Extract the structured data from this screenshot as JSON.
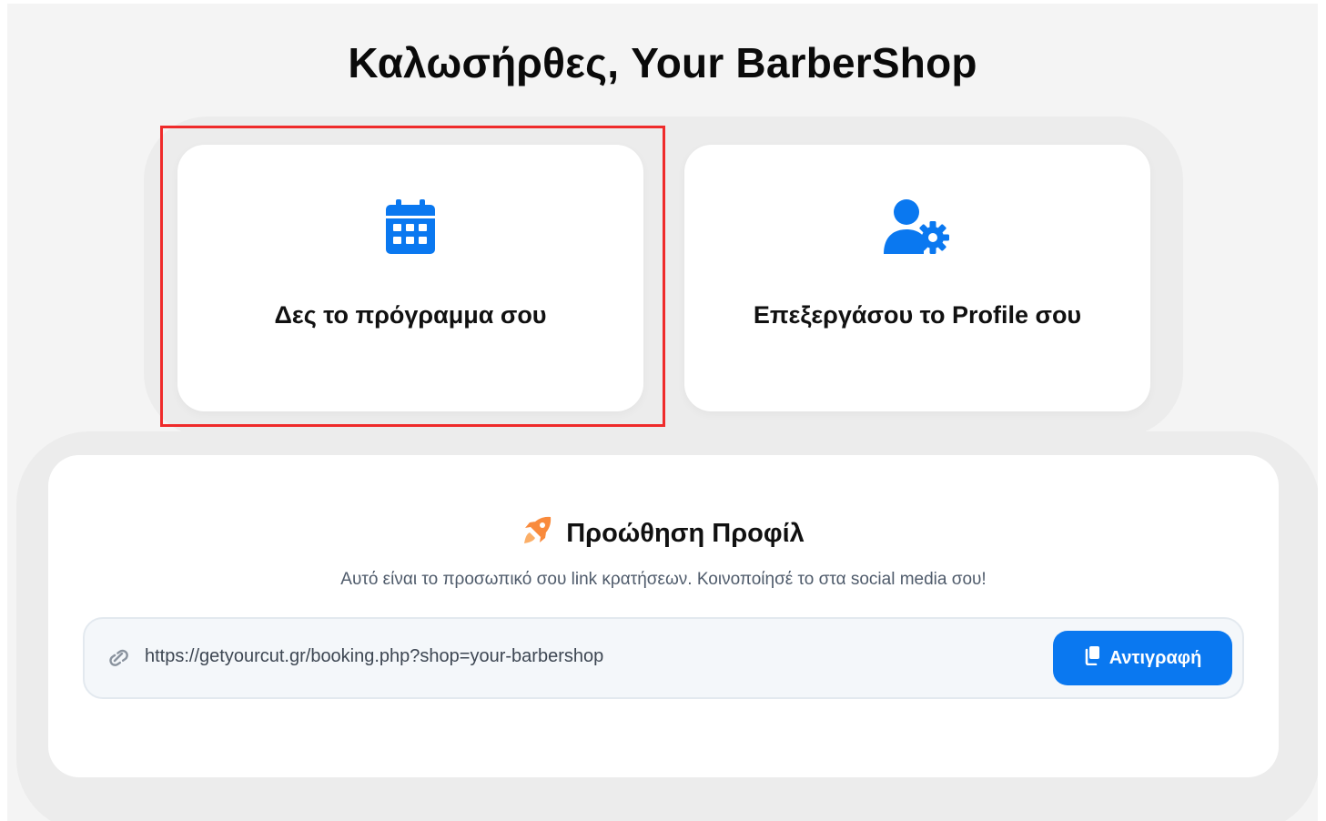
{
  "header": {
    "title": "Καλωσήρθες, Your BarberShop"
  },
  "cards": [
    {
      "label": "Δες το πρόγραμμα σου",
      "icon": "calendar-icon",
      "highlighted": true
    },
    {
      "label": "Επεξεργάσου το Profile σου",
      "icon": "user-gear-icon",
      "highlighted": false
    }
  ],
  "promo": {
    "icon": "rocket-icon",
    "title": "Προώθηση Προφίλ",
    "description": "Αυτό είναι το προσωπικό σου link κρατήσεων. Κοινοποίησέ το στα social media σου!",
    "link_icon": "link-icon",
    "link": "https://getyourcut.gr/booking.php?shop=your-barbershop",
    "copy_icon": "copy-icon",
    "copy_label": "Αντιγραφή"
  },
  "colors": {
    "accent": "#0a78f0",
    "highlight_border": "#ef2b2b",
    "rocket": "#f98a3c"
  }
}
